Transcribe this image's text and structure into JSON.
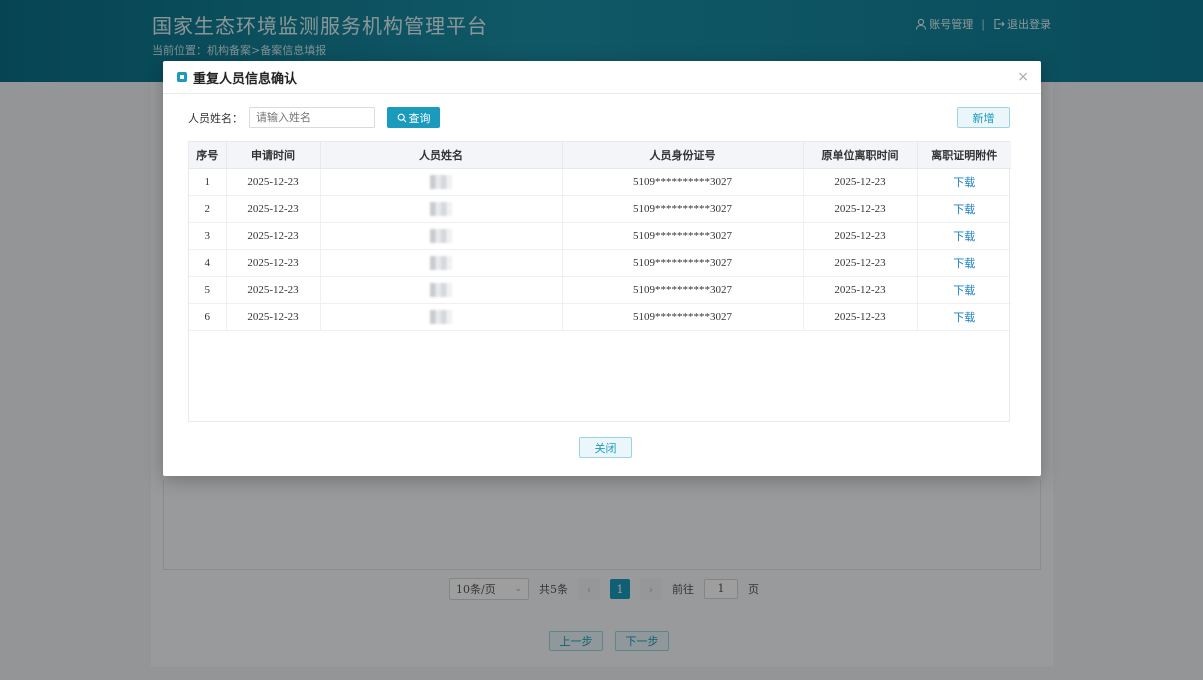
{
  "header": {
    "title": "国家生态环境监测服务机构管理平台",
    "breadcrumb": "当前位置：机构备案>备案信息填报",
    "account_label": "账号管理",
    "separator": "|",
    "logout_label": "退出登录"
  },
  "background": {
    "pagination": {
      "page_size": "10条/页",
      "total": "共5条",
      "current_page": "1",
      "goto_label": "前往",
      "goto_value": "1",
      "page_unit": "页"
    },
    "prev_label": "上一步",
    "next_label": "下一步"
  },
  "modal": {
    "title": "重复人员信息确认",
    "close_symbol": "×",
    "search": {
      "label": "人员姓名：",
      "placeholder": "请输入姓名",
      "button_label": "查询"
    },
    "add_label": "新增",
    "close_label": "关闭",
    "table": {
      "columns": [
        "序号",
        "申请时间",
        "人员姓名",
        "人员身份证号",
        "原单位离职时间",
        "离职证明附件"
      ],
      "rows": [
        {
          "index": "1",
          "apply_date": "2025-12-23",
          "id_number": "5109**********3027",
          "leave_date": "2025-12-23",
          "attachment": "下载"
        },
        {
          "index": "2",
          "apply_date": "2025-12-23",
          "id_number": "5109**********3027",
          "leave_date": "2025-12-23",
          "attachment": "下载"
        },
        {
          "index": "3",
          "apply_date": "2025-12-23",
          "id_number": "5109**********3027",
          "leave_date": "2025-12-23",
          "attachment": "下载"
        },
        {
          "index": "4",
          "apply_date": "2025-12-23",
          "id_number": "5109**********3027",
          "leave_date": "2025-12-23",
          "attachment": "下载"
        },
        {
          "index": "5",
          "apply_date": "2025-12-23",
          "id_number": "5109**********3027",
          "leave_date": "2025-12-23",
          "attachment": "下载"
        },
        {
          "index": "6",
          "apply_date": "2025-12-23",
          "id_number": "5109**********3027",
          "leave_date": "2025-12-23",
          "attachment": "下载"
        }
      ]
    }
  },
  "colors": {
    "accent": "#1a9bbd",
    "header_bg": "#0f7c95",
    "link": "#1a7fc8"
  },
  "icons": {
    "account": "user-icon",
    "logout": "logout-icon",
    "search": "search-icon",
    "title": "dialog-title-icon",
    "close": "close-icon"
  }
}
